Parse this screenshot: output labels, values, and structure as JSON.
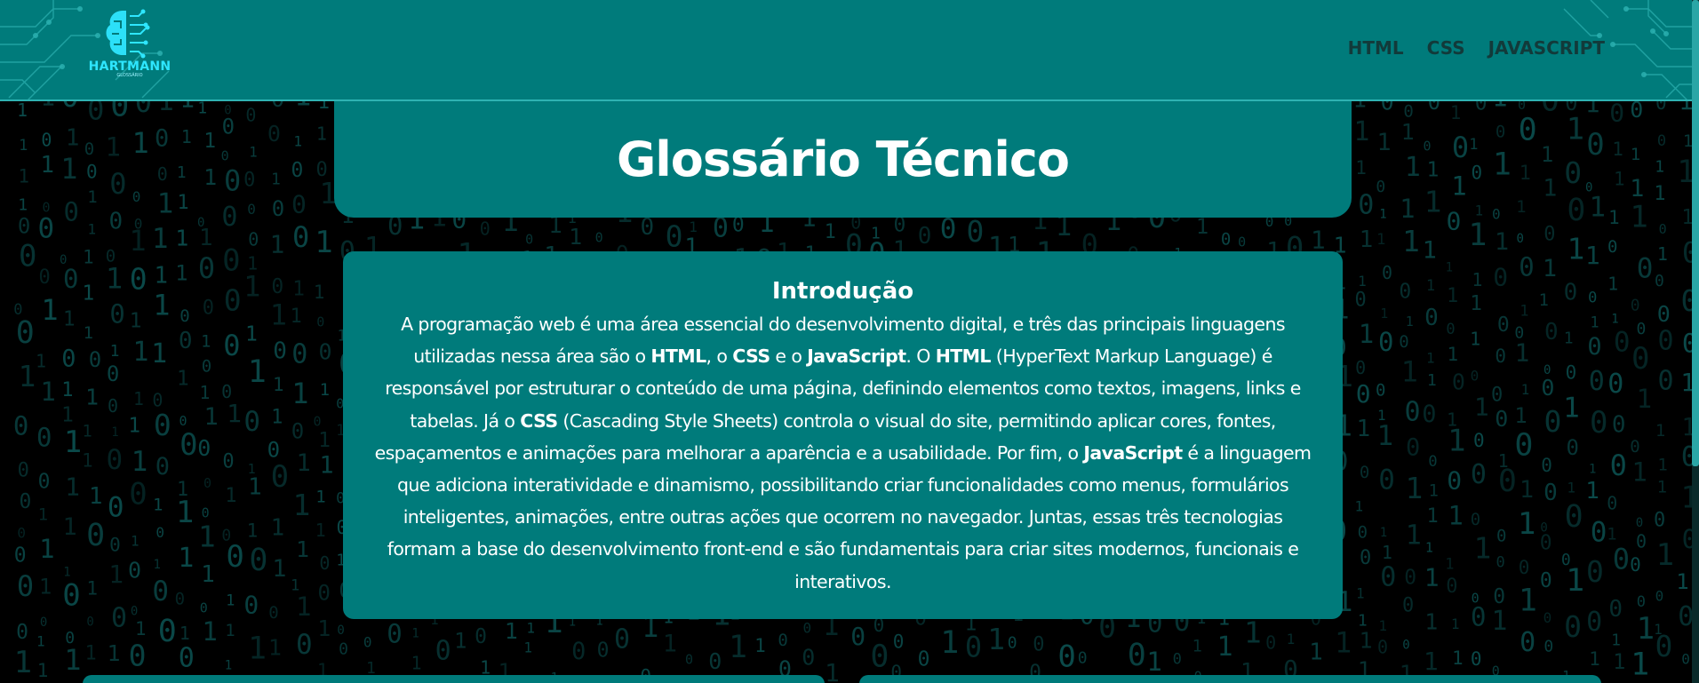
{
  "header": {
    "logo": {
      "brand": "HARTMANN",
      "subtitle": "GLOSSÁRIO"
    },
    "nav": [
      {
        "label": "HTML"
      },
      {
        "label": "CSS"
      },
      {
        "label": "JAVASCRIPT"
      }
    ]
  },
  "main": {
    "title": "Glossário Técnico",
    "intro": {
      "heading": "Introdução",
      "segments": [
        {
          "text": "A programação web é uma área essencial do desenvolvimento digital, e três das principais linguagens utilizadas nessa área são o ",
          "bold": false
        },
        {
          "text": "HTML",
          "bold": true
        },
        {
          "text": ", o ",
          "bold": false
        },
        {
          "text": "CSS",
          "bold": true
        },
        {
          "text": " e o ",
          "bold": false
        },
        {
          "text": "JavaScript",
          "bold": true
        },
        {
          "text": ". O ",
          "bold": false
        },
        {
          "text": "HTML",
          "bold": true
        },
        {
          "text": " (HyperText Markup Language) é responsável por estruturar o conteúdo de uma página, definindo elementos como textos, imagens, links e tabelas. Já o ",
          "bold": false
        },
        {
          "text": "CSS",
          "bold": true
        },
        {
          "text": " (Cascading Style Sheets) controla o visual do site, permitindo aplicar cores, fontes, espaçamentos e animações para melhorar a aparência e a usabilidade. Por fim, o ",
          "bold": false
        },
        {
          "text": "JavaScript",
          "bold": true
        },
        {
          "text": " é a linguagem que adiciona interatividade e dinamismo, possibilitando criar funcionalidades como menus, formulários inteligentes, animações, entre outras ações que ocorrem no navegador. Juntas, essas três tecnologias formam a base do desenvolvimento front-end e são fundamentais para criar sites modernos, funcionais e interativos.",
          "bold": false
        }
      ]
    }
  },
  "colors": {
    "teal": "#007b7b",
    "background": "#000000",
    "binary": "#0b4a4a",
    "logo_accent": "#2ee6ff",
    "nav_text": "#123a3a"
  },
  "icons": {
    "logo": "brain-circuit-icon",
    "background": "binary-rain"
  }
}
